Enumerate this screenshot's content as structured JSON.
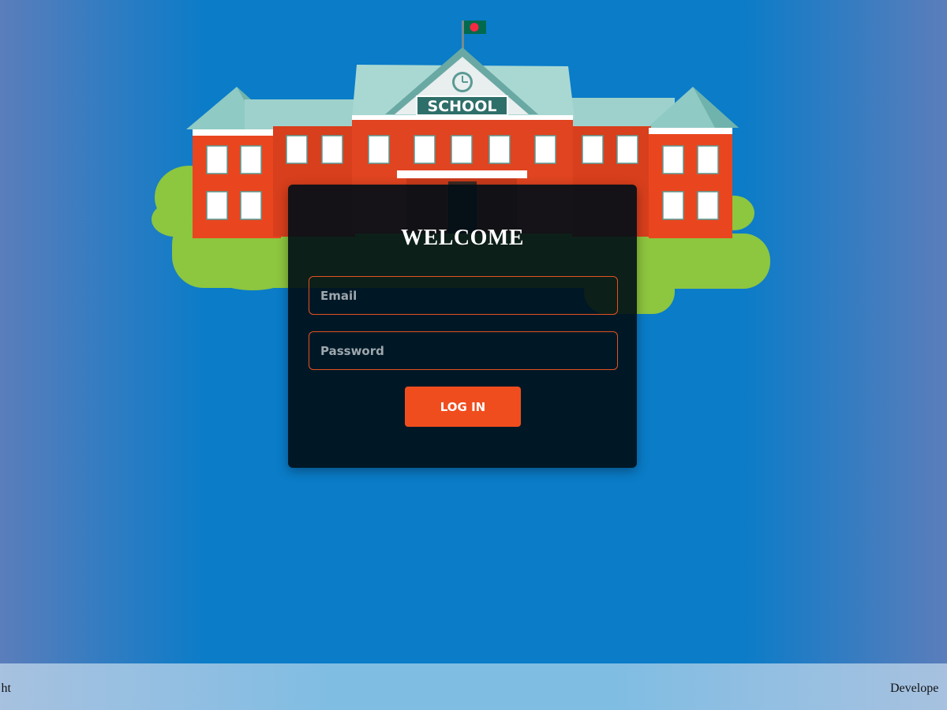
{
  "illustration": {
    "sign_text": "SCHOOL",
    "flag": "bangladesh-flag"
  },
  "login": {
    "title": "WELCOME",
    "email_placeholder": "Email",
    "email_value": "",
    "password_placeholder": "Password",
    "password_value": "",
    "button_label": "LOG IN"
  },
  "footer": {
    "left_text": "ht",
    "right_text": "Develope"
  },
  "colors": {
    "accent": "#f04d1e",
    "background": "#0a7cc8",
    "card": "#000e16"
  }
}
